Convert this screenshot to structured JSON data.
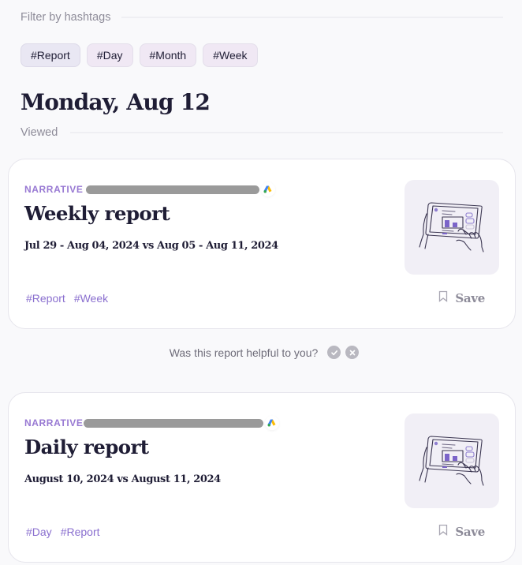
{
  "filter": {
    "label": "Filter by hashtags",
    "hashtags": [
      {
        "label": "#Report"
      },
      {
        "label": "#Day"
      },
      {
        "label": "#Month"
      },
      {
        "label": "#Week"
      }
    ]
  },
  "day": {
    "title": "Monday, Aug 12",
    "section_label": "Viewed"
  },
  "cards": [
    {
      "category": "NARRATIVE",
      "source_icon": "google-ads-icon",
      "title": "Weekly report",
      "subtitle": "Jul 29 - Aug 04, 2024 vs Aug 05 - Aug 11, 2024",
      "tags": [
        "#Report",
        "#Week"
      ],
      "save_label": "Save",
      "illustration": "tablet-report-illustration"
    },
    {
      "category": "NARRATIVE",
      "source_icon": "google-ads-icon",
      "title": "Daily report",
      "subtitle": "August 10, 2024 vs August 11, 2024",
      "tags": [
        "#Day",
        "#Report"
      ],
      "save_label": "Save",
      "illustration": "tablet-report-illustration"
    }
  ],
  "feedback": {
    "question": "Was this report helpful to you?",
    "yes_icon": "check-circle-icon",
    "no_icon": "x-circle-icon"
  },
  "colors": {
    "accent": "#9879d3",
    "tag": "#8a6fcf",
    "heading": "#1f1d35",
    "muted": "#8e8c99"
  }
}
